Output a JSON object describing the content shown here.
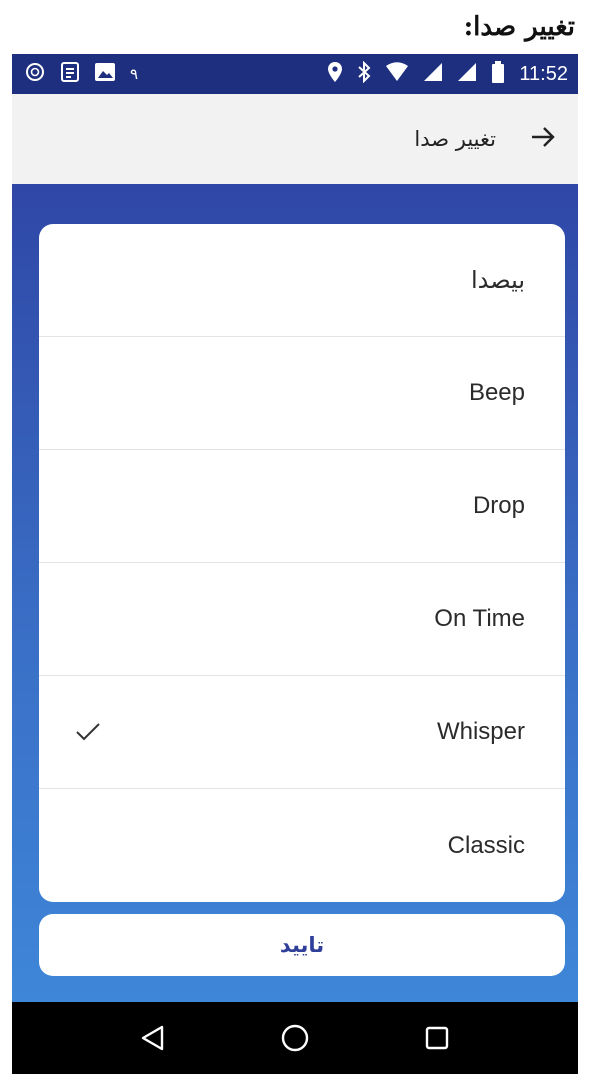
{
  "caption": "تغییر صدا:",
  "status_bar": {
    "time": "11:52",
    "notification_count": "٩",
    "icons": [
      "sync-icon",
      "document-icon",
      "image-icon",
      "location-icon",
      "bluetooth-icon",
      "wifi-icon",
      "signal-icon",
      "signal-icon",
      "battery-icon"
    ]
  },
  "app_bar": {
    "title": "تغییر صدا",
    "back_icon": "arrow-right-icon"
  },
  "sound_options": [
    {
      "label": "بیصدا",
      "selected": false
    },
    {
      "label": "Beep",
      "selected": false
    },
    {
      "label": "Drop",
      "selected": false
    },
    {
      "label": "On Time",
      "selected": false
    },
    {
      "label": "Whisper",
      "selected": true
    },
    {
      "label": "Classic",
      "selected": false
    }
  ],
  "confirm_button": {
    "label": "تایید"
  },
  "nav_bar": {
    "icons": [
      "back-triangle-icon",
      "home-circle-icon",
      "recents-square-icon"
    ]
  },
  "colors": {
    "status_bar": "#1e2f7f",
    "app_bar": "#f2f2f2",
    "gradient_top": "#2f47a6",
    "gradient_bottom": "#3e86d8",
    "confirm_text": "#2f3f9a"
  }
}
